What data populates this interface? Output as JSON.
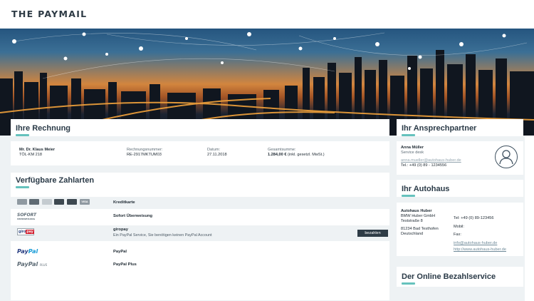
{
  "brand": {
    "logo_text": "THE PAYMAIL"
  },
  "colors": {
    "accent": "#66c2bd",
    "button": "#2e3c46"
  },
  "invoice": {
    "title": "Ihre Rechnung",
    "customer_name": "Mr. Dr. Klaus Meier",
    "customer_sub": "TÖL-KM 218",
    "number_label": "Rechnungsnummer:",
    "number_value": "RE-2917MKTUM03",
    "date_label": "Datum:",
    "date_value": "27.11.2018",
    "total_label": "Gesamtsumme:",
    "total_value": "1.284,00 €",
    "total_suffix": "(inkl. gesetzl. MwSt.)"
  },
  "payments": {
    "title": "Verfügbare Zahlarten",
    "methods": [
      {
        "label": "Kreditkarte",
        "icon": "credit-cards-icon"
      },
      {
        "label": "Sofort Überweisung",
        "icon": "sofort-icon",
        "logo_text": "SOFORT",
        "logo_sub": "ÜBERWEISUNG"
      },
      {
        "label": "giropay",
        "icon": "giropay-icon",
        "logo_text_a": "giro",
        "logo_text_b": "pay",
        "description": "Ein PayPal Service, Sie benötigen keinen PayPal Account",
        "button": "bezahlen"
      },
      {
        "label": "PayPal",
        "icon": "paypal-icon",
        "logo_text_a": "Pay",
        "logo_text_b": "Pal"
      },
      {
        "label": "PayPal Plus",
        "icon": "paypal-plus-icon",
        "logo_text_a": "Pay",
        "logo_text_b": "Pal",
        "logo_suffix": "PLUS"
      }
    ],
    "card_brands": [
      "VISA"
    ]
  },
  "contact": {
    "title": "Ihr Ansprechpartner",
    "name": "Anna Müller",
    "role": "Service desk",
    "email": "anna.mueller@autohaus-huber.de",
    "phone": "Tel.: +49 (0) 89 - 1234556"
  },
  "dealer": {
    "title": "Ihr Autohaus",
    "name": "Autohaus Huber",
    "company": "BMW Huber GmbH",
    "street": "Teststraße 8",
    "city": "81234 Bad Testhofen",
    "country": "Deutschland",
    "tel": "Tel: +49 (0) 89-123456",
    "mobile": "Mobil:",
    "fax": "Fax:",
    "email": "info@autohaus-huber.de",
    "web": "http://www.autohaus-huber.de"
  },
  "online_service": {
    "title": "Der Online Bezahlservice"
  }
}
